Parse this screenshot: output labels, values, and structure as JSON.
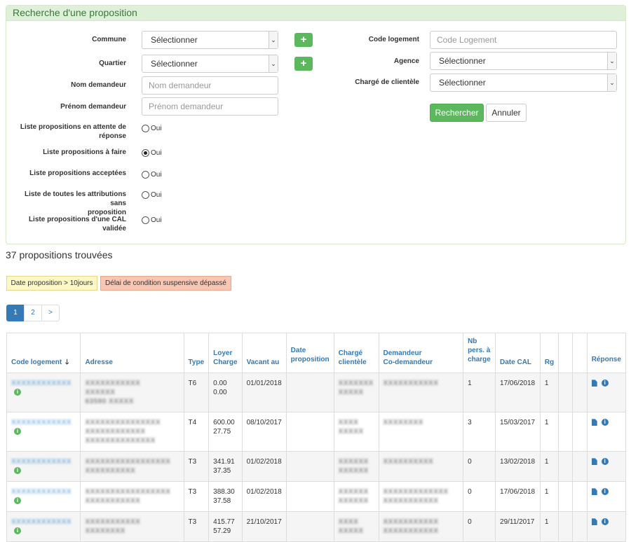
{
  "search": {
    "title": "Recherche d'une proposition",
    "labels": {
      "commune": "Commune",
      "quartier": "Quartier",
      "nom": "Nom demandeur",
      "prenom": "Prénom demandeur",
      "attente_1": "Liste propositions en attente de",
      "attente_2": "réponse",
      "afaire": "Liste propositions à faire",
      "acceptees": "Liste propositions acceptées",
      "toutes_1": "Liste de toutes les attributions sans",
      "toutes_2": "proposition",
      "cal_1": "Liste propositions d'une CAL",
      "cal_2": "validée",
      "code": "Code logement",
      "agence": "Agence",
      "charge": "Chargé de clientèle"
    },
    "select_default": "Sélectionner",
    "placeholders": {
      "nom": "Nom demandeur",
      "prenom": "Prénom demandeur",
      "code": "Code Logement"
    },
    "radio_label": "Oui",
    "radio_selected": "afaire",
    "buttons": {
      "search": "Rechercher",
      "cancel": "Annuler",
      "plus": "+"
    }
  },
  "results": {
    "count": "37 propositions trouvées",
    "legend_date": "Date proposition > 10jours",
    "legend_delay": "Délai de condition suspensive dépassé",
    "pages": [
      "1",
      "2",
      ">"
    ],
    "columns": {
      "code": "Code logement",
      "adresse": "Adresse",
      "type": "Type",
      "loyer_1": "Loyer",
      "loyer_2": "Charge",
      "vacant": "Vacant au",
      "datep_1": "Date",
      "datep_2": "proposition",
      "charge_1": "Chargé",
      "charge_2": "clientèle",
      "dem_1": "Demandeur",
      "dem_2": "Co-demandeur",
      "nb_1": "Nb",
      "nb_2": "pers. à",
      "nb_2b": "charge",
      "datecal": "Date CAL",
      "rg": "Rg",
      "reponse": "Réponse"
    },
    "sort_arrow": "🡓",
    "rows": [
      {
        "code": "XXXXXXXXXXXX",
        "addr": [
          "XXXXXXXXXXX",
          "XXXXXX",
          "63590 XXXXX"
        ],
        "type": "T6",
        "loyer": "0.00",
        "charge": "0.00",
        "vacant": "01/01/2018",
        "datep": "",
        "cc": [
          "XXXXXXX",
          "XXXXX"
        ],
        "dem": [
          "XXXXXXXXXXX"
        ],
        "nb": "1",
        "datecal": "17/06/2018",
        "rg": "1"
      },
      {
        "code": "XXXXXXXXXXXX",
        "addr": [
          "XXXXXXXXXXXXXXX",
          "XXXXXXXXXXXX",
          "XXXXXXXXXXXXXX"
        ],
        "type": "T4",
        "loyer": "600.00",
        "charge": "27.75",
        "vacant": "08/10/2017",
        "datep": "",
        "cc": [
          "XXXX",
          "XXXXX"
        ],
        "dem": [
          "XXXXXXXX"
        ],
        "nb": "3",
        "datecal": "15/03/2017",
        "rg": "1"
      },
      {
        "code": "XXXXXXXXXXXX",
        "addr": [
          "XXXXXXXXXXXXXXXXX",
          "XXXXXXXXXX"
        ],
        "type": "T3",
        "loyer": "341.91",
        "charge": "37.35",
        "vacant": "01/02/2018",
        "datep": "",
        "cc": [
          "XXXXXX",
          "XXXXXX"
        ],
        "dem": [
          "XXXXXXXXXX"
        ],
        "nb": "0",
        "datecal": "13/02/2018",
        "rg": "1"
      },
      {
        "code": "XXXXXXXXXXXX",
        "addr": [
          "XXXXXXXXXXXXXXXXX",
          "XXXXXXXXXXX"
        ],
        "type": "T3",
        "loyer": "388.30",
        "charge": "37.58",
        "vacant": "01/02/2018",
        "datep": "",
        "cc": [
          "XXXXXX",
          "XXXXXX"
        ],
        "dem": [
          "XXXXXXXXXXXXX",
          "XXXXXXXXXXX"
        ],
        "nb": "0",
        "datecal": "17/06/2018",
        "rg": "1"
      },
      {
        "code": "XXXXXXXXXXXX",
        "addr": [
          "XXXXXXXXXXX",
          "XXXXXXXX"
        ],
        "type": "T3",
        "loyer": "415.77",
        "charge": "57.29",
        "vacant": "21/10/2017",
        "datep": "",
        "cc": [
          "XXXX",
          "XXXXX"
        ],
        "dem": [
          "XXXXXXXXXXX",
          "XXXXXXXXXXX"
        ],
        "nb": "0",
        "datecal": "29/11/2017",
        "rg": "1"
      }
    ]
  },
  "colors": {
    "panel_header_bg": "#dff0d8",
    "primary_green": "#5cb85c",
    "link_blue": "#337ab7",
    "legend_yellow": "#fcf8c5",
    "legend_red": "#f8c7b3"
  }
}
